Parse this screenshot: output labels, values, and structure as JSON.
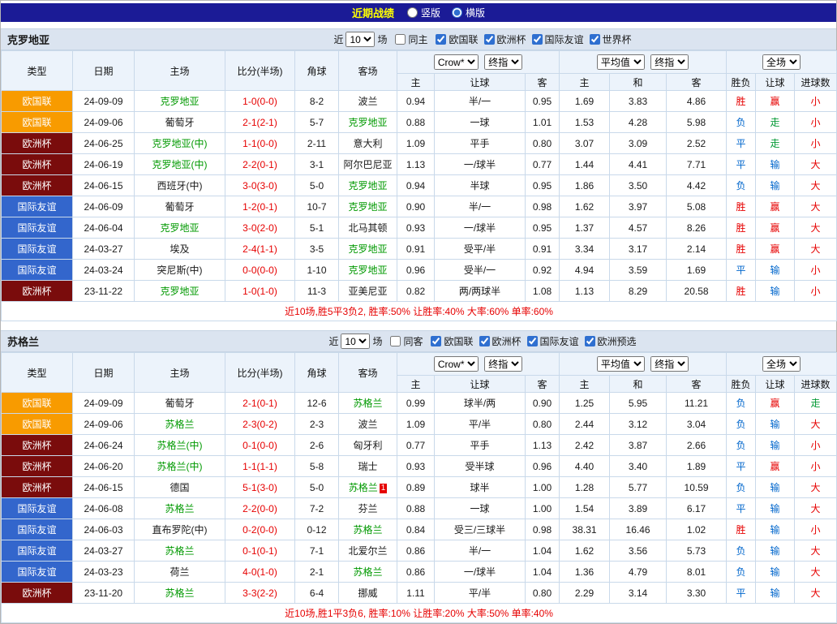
{
  "colors": {
    "navy": "#1b1b96",
    "title_yellow": "#ffff00",
    "league_orange": "#f89b00",
    "league_maroon": "#7a0c0c",
    "league_blue": "#3366cc",
    "team_green": "#009900",
    "score_red": "#e60000",
    "win_red": "#e60000",
    "loss_blue": "#0066cc",
    "push_green": "#009933",
    "summary_red": "#e60000"
  },
  "top_bar": {
    "title": "近期战绩",
    "layout_options": [
      {
        "label": "竖版",
        "selected": false
      },
      {
        "label": "横版",
        "selected": true
      }
    ]
  },
  "table_headers": {
    "static": [
      "类型",
      "日期",
      "主场",
      "比分(半场)",
      "角球",
      "客场"
    ],
    "odds_sub": [
      "主",
      "让球",
      "客"
    ],
    "avg_sub": [
      "主",
      "和",
      "客"
    ],
    "result_sub": [
      "胜负",
      "让球",
      "进球数"
    ]
  },
  "sections": [
    {
      "team": "克罗地亚",
      "filter": {
        "prefix": "近",
        "count": "10",
        "suffix": "场",
        "same_venue": {
          "label": "同主",
          "checked": false
        },
        "competitions": [
          {
            "label": "欧国联",
            "checked": true
          },
          {
            "label": "欧洲杯",
            "checked": true
          },
          {
            "label": "国际友谊",
            "checked": true
          },
          {
            "label": "世界杯",
            "checked": true
          }
        ]
      },
      "dropdowns": {
        "odds_source": "Crow*",
        "odds_stage": "终指",
        "avg_source": "平均值",
        "avg_stage": "终指",
        "scope": "全场"
      },
      "rows": [
        {
          "type": "欧国联",
          "type_color": "orange",
          "date": "24-09-09",
          "home": "克罗地亚",
          "home_highlight": true,
          "score": "1-0(0-0)",
          "corners": "8-2",
          "away": "波兰",
          "away_highlight": false,
          "away_badge": "",
          "crow_home": "0.94",
          "crow_handicap": "半/一",
          "crow_away": "0.95",
          "avg_home": "1.69",
          "avg_draw": "3.83",
          "avg_away": "4.86",
          "result": "胜",
          "result_color": "red",
          "handicap_result": "赢",
          "handicap_result_color": "red",
          "goals": "小",
          "goals_color": "red"
        },
        {
          "type": "欧国联",
          "type_color": "orange",
          "date": "24-09-06",
          "home": "葡萄牙",
          "home_highlight": false,
          "score": "2-1(2-1)",
          "corners": "5-7",
          "away": "克罗地亚",
          "away_highlight": true,
          "away_badge": "",
          "crow_home": "0.88",
          "crow_handicap": "一球",
          "crow_away": "1.01",
          "avg_home": "1.53",
          "avg_draw": "4.28",
          "avg_away": "5.98",
          "result": "负",
          "result_color": "blue",
          "handicap_result": "走",
          "handicap_result_color": "green",
          "goals": "小",
          "goals_color": "red"
        },
        {
          "type": "欧洲杯",
          "type_color": "maroon",
          "date": "24-06-25",
          "home": "克罗地亚(中)",
          "home_highlight": true,
          "score": "1-1(0-0)",
          "corners": "2-11",
          "away": "意大利",
          "away_highlight": false,
          "away_badge": "",
          "crow_home": "1.09",
          "crow_handicap": "平手",
          "crow_away": "0.80",
          "avg_home": "3.07",
          "avg_draw": "3.09",
          "avg_away": "2.52",
          "result": "平",
          "result_color": "blue",
          "handicap_result": "走",
          "handicap_result_color": "green",
          "goals": "小",
          "goals_color": "red"
        },
        {
          "type": "欧洲杯",
          "type_color": "maroon",
          "date": "24-06-19",
          "home": "克罗地亚(中)",
          "home_highlight": true,
          "score": "2-2(0-1)",
          "corners": "3-1",
          "away": "阿尔巴尼亚",
          "away_highlight": false,
          "away_badge": "",
          "crow_home": "1.13",
          "crow_handicap": "一/球半",
          "crow_away": "0.77",
          "avg_home": "1.44",
          "avg_draw": "4.41",
          "avg_away": "7.71",
          "result": "平",
          "result_color": "blue",
          "handicap_result": "输",
          "handicap_result_color": "blue",
          "goals": "大",
          "goals_color": "red"
        },
        {
          "type": "欧洲杯",
          "type_color": "maroon",
          "date": "24-06-15",
          "home": "西班牙(中)",
          "home_highlight": false,
          "score": "3-0(3-0)",
          "corners": "5-0",
          "away": "克罗地亚",
          "away_highlight": true,
          "away_badge": "",
          "crow_home": "0.94",
          "crow_handicap": "半球",
          "crow_away": "0.95",
          "avg_home": "1.86",
          "avg_draw": "3.50",
          "avg_away": "4.42",
          "result": "负",
          "result_color": "blue",
          "handicap_result": "输",
          "handicap_result_color": "blue",
          "goals": "大",
          "goals_color": "red"
        },
        {
          "type": "国际友谊",
          "type_color": "blue",
          "date": "24-06-09",
          "home": "葡萄牙",
          "home_highlight": false,
          "score": "1-2(0-1)",
          "corners": "10-7",
          "away": "克罗地亚",
          "away_highlight": true,
          "away_badge": "",
          "crow_home": "0.90",
          "crow_handicap": "半/一",
          "crow_away": "0.98",
          "avg_home": "1.62",
          "avg_draw": "3.97",
          "avg_away": "5.08",
          "result": "胜",
          "result_color": "red",
          "handicap_result": "赢",
          "handicap_result_color": "red",
          "goals": "大",
          "goals_color": "red"
        },
        {
          "type": "国际友谊",
          "type_color": "blue",
          "date": "24-06-04",
          "home": "克罗地亚",
          "home_highlight": true,
          "score": "3-0(2-0)",
          "corners": "5-1",
          "away": "北马其顿",
          "away_highlight": false,
          "away_badge": "",
          "crow_home": "0.93",
          "crow_handicap": "一/球半",
          "crow_away": "0.95",
          "avg_home": "1.37",
          "avg_draw": "4.57",
          "avg_away": "8.26",
          "result": "胜",
          "result_color": "red",
          "handicap_result": "赢",
          "handicap_result_color": "red",
          "goals": "大",
          "goals_color": "red"
        },
        {
          "type": "国际友谊",
          "type_color": "blue",
          "date": "24-03-27",
          "home": "埃及",
          "home_highlight": false,
          "score": "2-4(1-1)",
          "corners": "3-5",
          "away": "克罗地亚",
          "away_highlight": true,
          "away_badge": "",
          "crow_home": "0.91",
          "crow_handicap": "受平/半",
          "crow_away": "0.91",
          "avg_home": "3.34",
          "avg_draw": "3.17",
          "avg_away": "2.14",
          "result": "胜",
          "result_color": "red",
          "handicap_result": "赢",
          "handicap_result_color": "red",
          "goals": "大",
          "goals_color": "red"
        },
        {
          "type": "国际友谊",
          "type_color": "blue",
          "date": "24-03-24",
          "home": "突尼斯(中)",
          "home_highlight": false,
          "score": "0-0(0-0)",
          "corners": "1-10",
          "away": "克罗地亚",
          "away_highlight": true,
          "away_badge": "",
          "crow_home": "0.96",
          "crow_handicap": "受半/一",
          "crow_away": "0.92",
          "avg_home": "4.94",
          "avg_draw": "3.59",
          "avg_away": "1.69",
          "result": "平",
          "result_color": "blue",
          "handicap_result": "输",
          "handicap_result_color": "blue",
          "goals": "小",
          "goals_color": "red"
        },
        {
          "type": "欧洲杯",
          "type_color": "maroon",
          "date": "23-11-22",
          "home": "克罗地亚",
          "home_highlight": true,
          "score": "1-0(1-0)",
          "corners": "11-3",
          "away": "亚美尼亚",
          "away_highlight": false,
          "away_badge": "",
          "crow_home": "0.82",
          "crow_handicap": "两/两球半",
          "crow_away": "1.08",
          "avg_home": "1.13",
          "avg_draw": "8.29",
          "avg_away": "20.58",
          "result": "胜",
          "result_color": "red",
          "handicap_result": "输",
          "handicap_result_color": "blue",
          "goals": "小",
          "goals_color": "red"
        }
      ],
      "summary": "近10场,胜5平3负2, 胜率:50% 让胜率:40% 大率:60% 单率:60%"
    },
    {
      "team": "苏格兰",
      "filter": {
        "prefix": "近",
        "count": "10",
        "suffix": "场",
        "same_venue": {
          "label": "同客",
          "checked": false
        },
        "competitions": [
          {
            "label": "欧国联",
            "checked": true
          },
          {
            "label": "欧洲杯",
            "checked": true
          },
          {
            "label": "国际友谊",
            "checked": true
          },
          {
            "label": "欧洲预选",
            "checked": true
          }
        ]
      },
      "dropdowns": {
        "odds_source": "Crow*",
        "odds_stage": "终指",
        "avg_source": "平均值",
        "avg_stage": "终指",
        "scope": "全场"
      },
      "rows": [
        {
          "type": "欧国联",
          "type_color": "orange",
          "date": "24-09-09",
          "home": "葡萄牙",
          "home_highlight": false,
          "score": "2-1(0-1)",
          "corners": "12-6",
          "away": "苏格兰",
          "away_highlight": true,
          "away_badge": "",
          "crow_home": "0.99",
          "crow_handicap": "球半/两",
          "crow_away": "0.90",
          "avg_home": "1.25",
          "avg_draw": "5.95",
          "avg_away": "11.21",
          "result": "负",
          "result_color": "blue",
          "handicap_result": "赢",
          "handicap_result_color": "red",
          "goals": "走",
          "goals_color": "green"
        },
        {
          "type": "欧国联",
          "type_color": "orange",
          "date": "24-09-06",
          "home": "苏格兰",
          "home_highlight": true,
          "score": "2-3(0-2)",
          "corners": "2-3",
          "away": "波兰",
          "away_highlight": false,
          "away_badge": "",
          "crow_home": "1.09",
          "crow_handicap": "平/半",
          "crow_away": "0.80",
          "avg_home": "2.44",
          "avg_draw": "3.12",
          "avg_away": "3.04",
          "result": "负",
          "result_color": "blue",
          "handicap_result": "输",
          "handicap_result_color": "blue",
          "goals": "大",
          "goals_color": "red"
        },
        {
          "type": "欧洲杯",
          "type_color": "maroon",
          "date": "24-06-24",
          "home": "苏格兰(中)",
          "home_highlight": true,
          "score": "0-1(0-0)",
          "corners": "2-6",
          "away": "匈牙利",
          "away_highlight": false,
          "away_badge": "",
          "crow_home": "0.77",
          "crow_handicap": "平手",
          "crow_away": "1.13",
          "avg_home": "2.42",
          "avg_draw": "3.87",
          "avg_away": "2.66",
          "result": "负",
          "result_color": "blue",
          "handicap_result": "输",
          "handicap_result_color": "blue",
          "goals": "小",
          "goals_color": "red"
        },
        {
          "type": "欧洲杯",
          "type_color": "maroon",
          "date": "24-06-20",
          "home": "苏格兰(中)",
          "home_highlight": true,
          "score": "1-1(1-1)",
          "corners": "5-8",
          "away": "瑞士",
          "away_highlight": false,
          "away_badge": "",
          "crow_home": "0.93",
          "crow_handicap": "受半球",
          "crow_away": "0.96",
          "avg_home": "4.40",
          "avg_draw": "3.40",
          "avg_away": "1.89",
          "result": "平",
          "result_color": "blue",
          "handicap_result": "赢",
          "handicap_result_color": "red",
          "goals": "小",
          "goals_color": "red"
        },
        {
          "type": "欧洲杯",
          "type_color": "maroon",
          "date": "24-06-15",
          "home": "德国",
          "home_highlight": false,
          "score": "5-1(3-0)",
          "corners": "5-0",
          "away": "苏格兰",
          "away_highlight": true,
          "away_badge": "1",
          "crow_home": "0.89",
          "crow_handicap": "球半",
          "crow_away": "1.00",
          "avg_home": "1.28",
          "avg_draw": "5.77",
          "avg_away": "10.59",
          "result": "负",
          "result_color": "blue",
          "handicap_result": "输",
          "handicap_result_color": "blue",
          "goals": "大",
          "goals_color": "red"
        },
        {
          "type": "国际友谊",
          "type_color": "blue",
          "date": "24-06-08",
          "home": "苏格兰",
          "home_highlight": true,
          "score": "2-2(0-0)",
          "corners": "7-2",
          "away": "芬兰",
          "away_highlight": false,
          "away_badge": "",
          "crow_home": "0.88",
          "crow_handicap": "一球",
          "crow_away": "1.00",
          "avg_home": "1.54",
          "avg_draw": "3.89",
          "avg_away": "6.17",
          "result": "平",
          "result_color": "blue",
          "handicap_result": "输",
          "handicap_result_color": "blue",
          "goals": "大",
          "goals_color": "red"
        },
        {
          "type": "国际友谊",
          "type_color": "blue",
          "date": "24-06-03",
          "home": "直布罗陀(中)",
          "home_highlight": false,
          "score": "0-2(0-0)",
          "corners": "0-12",
          "away": "苏格兰",
          "away_highlight": true,
          "away_badge": "",
          "crow_home": "0.84",
          "crow_handicap": "受三/三球半",
          "crow_away": "0.98",
          "avg_home": "38.31",
          "avg_draw": "16.46",
          "avg_away": "1.02",
          "result": "胜",
          "result_color": "red",
          "handicap_result": "输",
          "handicap_result_color": "blue",
          "goals": "小",
          "goals_color": "red"
        },
        {
          "type": "国际友谊",
          "type_color": "blue",
          "date": "24-03-27",
          "home": "苏格兰",
          "home_highlight": true,
          "score": "0-1(0-1)",
          "corners": "7-1",
          "away": "北爱尔兰",
          "away_highlight": false,
          "away_badge": "",
          "crow_home": "0.86",
          "crow_handicap": "半/一",
          "crow_away": "1.04",
          "avg_home": "1.62",
          "avg_draw": "3.56",
          "avg_away": "5.73",
          "result": "负",
          "result_color": "blue",
          "handicap_result": "输",
          "handicap_result_color": "blue",
          "goals": "大",
          "goals_color": "red"
        },
        {
          "type": "国际友谊",
          "type_color": "blue",
          "date": "24-03-23",
          "home": "荷兰",
          "home_highlight": false,
          "score": "4-0(1-0)",
          "corners": "2-1",
          "away": "苏格兰",
          "away_highlight": true,
          "away_badge": "",
          "crow_home": "0.86",
          "crow_handicap": "一/球半",
          "crow_away": "1.04",
          "avg_home": "1.36",
          "avg_draw": "4.79",
          "avg_away": "8.01",
          "result": "负",
          "result_color": "blue",
          "handicap_result": "输",
          "handicap_result_color": "blue",
          "goals": "大",
          "goals_color": "red"
        },
        {
          "type": "欧洲杯",
          "type_color": "maroon",
          "date": "23-11-20",
          "home": "苏格兰",
          "home_highlight": true,
          "score": "3-3(2-2)",
          "corners": "6-4",
          "away": "挪威",
          "away_highlight": false,
          "away_badge": "",
          "crow_home": "1.11",
          "crow_handicap": "平/半",
          "crow_away": "0.80",
          "avg_home": "2.29",
          "avg_draw": "3.14",
          "avg_away": "3.30",
          "result": "平",
          "result_color": "blue",
          "handicap_result": "输",
          "handicap_result_color": "blue",
          "goals": "大",
          "goals_color": "red"
        }
      ],
      "summary": "近10场,胜1平3负6, 胜率:10% 让胜率:20% 大率:50% 单率:40%"
    }
  ]
}
